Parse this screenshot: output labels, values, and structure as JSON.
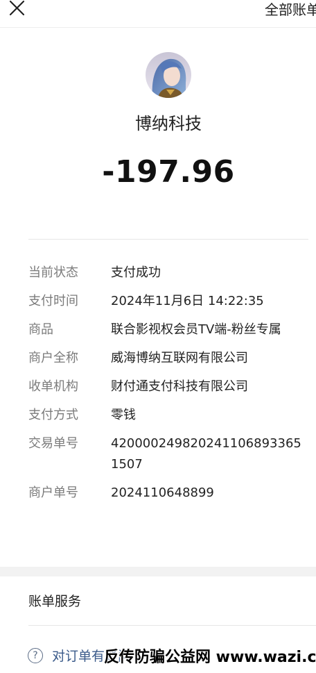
{
  "header": {
    "all_bills_label": "全部账单"
  },
  "merchant": {
    "name": "博纳科技",
    "amount": "-197.96"
  },
  "details": [
    {
      "label": "当前状态",
      "value": "支付成功"
    },
    {
      "label": "支付时间",
      "value": "2024年11月6日 14:22:35"
    },
    {
      "label": "商品",
      "value": "联合影视权会员TV端-粉丝专属"
    },
    {
      "label": "商户全称",
      "value": "威海博纳互联网有限公司"
    },
    {
      "label": "收单机构",
      "value": "财付通支付科技有限公司"
    },
    {
      "label": "支付方式",
      "value": "零钱"
    },
    {
      "label": "交易单号",
      "value": "4200002498202411068933651507"
    },
    {
      "label": "商户单号",
      "value": "2024110648899"
    }
  ],
  "services": {
    "title": "账单服务",
    "question_label": "对订单有疑问"
  },
  "watermark": "反传防骗公益网 www.wazi.cc",
  "icons": {
    "close": "close-icon",
    "question": "question-circle-icon"
  }
}
